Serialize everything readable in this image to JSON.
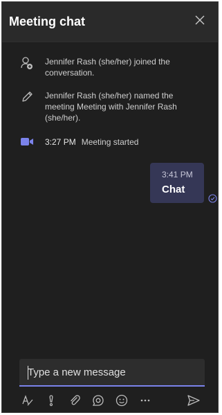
{
  "header": {
    "title": "Meeting chat"
  },
  "system_messages": [
    {
      "icon": "person-add-icon",
      "text": "Jennifer Rash (she/her) joined the conversation."
    },
    {
      "icon": "pencil-icon",
      "text": "Jennifer Rash (she/her) named the meeting Meeting with Jennifer Rash (she/her)."
    },
    {
      "icon": "video-camera-icon",
      "time": "3:27 PM",
      "text": "Meeting started"
    }
  ],
  "chat": {
    "bubble_time": "3:41 PM",
    "bubble_text": "Chat",
    "status": "seen"
  },
  "composer": {
    "placeholder": "Type a new message"
  },
  "toolbar": [
    "format-icon",
    "important-icon",
    "attach-icon",
    "loop-icon",
    "emoji-icon",
    "more-icon",
    "send-icon"
  ],
  "colors": {
    "background": "#1f1f1f",
    "header": "#2a2a2a",
    "bubble": "#353756",
    "accent": "#7b83eb"
  }
}
